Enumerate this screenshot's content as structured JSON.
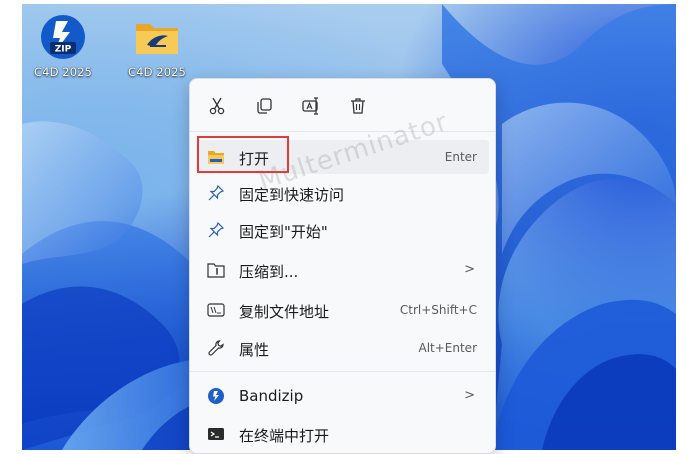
{
  "desktop": {
    "icons": [
      {
        "label": "C4D 2025",
        "icon": "zip-archive-icon",
        "badge": "ZIP"
      },
      {
        "label": "C4D 2025",
        "icon": "folder-icon"
      }
    ]
  },
  "context_menu": {
    "toolbar": [
      {
        "name": "cut",
        "icon": "scissors-icon"
      },
      {
        "name": "copy",
        "icon": "copy-icon"
      },
      {
        "name": "rename",
        "icon": "rename-icon"
      },
      {
        "name": "delete",
        "icon": "trash-icon"
      }
    ],
    "items": [
      {
        "label": "打开",
        "shortcut": "Enter",
        "icon": "folder-icon"
      },
      {
        "label": "固定到快速访问",
        "icon": "pin-icon"
      },
      {
        "label": "固定到\"开始\"",
        "icon": "pin-icon"
      },
      {
        "label": "压缩到...",
        "icon": "archive-icon",
        "has_submenu": true,
        "arrow": ">"
      },
      {
        "label": "复制文件地址",
        "shortcut": "Ctrl+Shift+C",
        "icon": "path-copy-icon"
      },
      {
        "label": "属性",
        "shortcut": "Alt+Enter",
        "icon": "wrench-icon"
      },
      {
        "label": "Bandizip",
        "icon": "bandizip-icon",
        "has_submenu": true,
        "arrow": ">"
      },
      {
        "label": "在终端中打开",
        "icon": "terminal-icon"
      }
    ]
  },
  "watermark": "Multerminator",
  "colors": {
    "highlight": "#e03c3c",
    "folder": "#f3b63b",
    "accent": "#0f5fd0"
  }
}
